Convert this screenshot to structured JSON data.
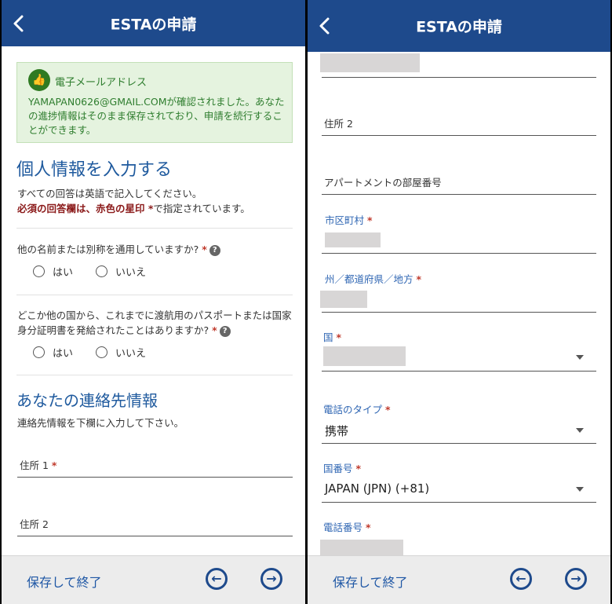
{
  "header": {
    "title": "ESTAの申請"
  },
  "left": {
    "notice": {
      "title": "電子メールアドレス",
      "body": "YAMAPAN0626@GMAIL.COMが確認されました。あなたの進捗情報はそのまま保存されており、申請を続行することができます。"
    },
    "personal": {
      "heading": "個人情報を入力する",
      "instruction": "すべての回答は英語で記入してください。",
      "required_bold": "必須の回答欄は、赤色の星印 *",
      "required_rest": "で指定されています。"
    },
    "q1": {
      "text": "他の名前または別称を通用していますか?",
      "yes": "はい",
      "no": "いいえ"
    },
    "q2": {
      "text": "どこか他の国から、これまでに渡航用のパスポートまたは国家身分証明書を発給されたことはありますか?",
      "yes": "はい",
      "no": "いいえ"
    },
    "contact": {
      "heading": "あなたの連絡先情報",
      "instruction": "連絡先情報を下欄に入力して下さい。",
      "address1": "住所 1",
      "address2": "住所 2"
    }
  },
  "right": {
    "address2": "住所 2",
    "apartment": "アパートメントの部屋番号",
    "city": "市区町村",
    "state": "州／都道府県／地方",
    "country": "国",
    "phone_type_label": "電話のタイプ",
    "phone_type_value": "携帯",
    "country_code_label": "国番号",
    "country_code_value": "JAPAN (JPN) (+81)",
    "phone_number_label": "電話番号"
  },
  "footer": {
    "save_label": "保存して終了"
  },
  "icons": {
    "back": "chevron-left-icon",
    "prev": "arrow-left-circle-icon",
    "next": "arrow-right-circle-icon",
    "thumbs": "thumbs-up-icon",
    "help": "question-circle-icon"
  },
  "colors": {
    "header": "#1e4a8c",
    "accent": "#1f5a9e",
    "required": "#c0392b",
    "notice_bg": "#e5f3df"
  }
}
